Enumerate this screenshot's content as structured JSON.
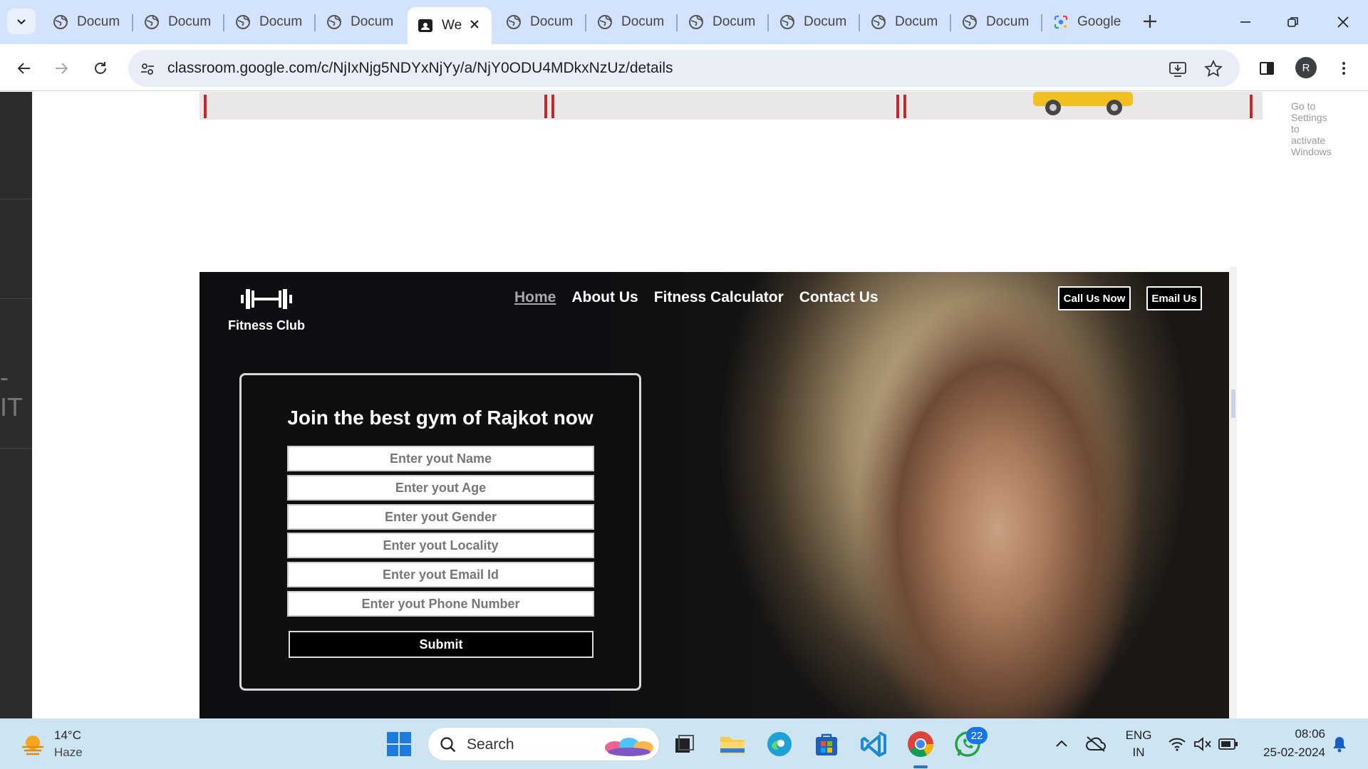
{
  "browser": {
    "tabs": [
      {
        "title": "Docum",
        "active": false
      },
      {
        "title": "Docum",
        "active": false
      },
      {
        "title": "Docum",
        "active": false
      },
      {
        "title": "Docum",
        "active": false
      },
      {
        "title": "We",
        "active": true
      },
      {
        "title": "Docum",
        "active": false
      },
      {
        "title": "Docum",
        "active": false
      },
      {
        "title": "Docum",
        "active": false
      },
      {
        "title": "Docum",
        "active": false
      },
      {
        "title": "Docum",
        "active": false
      },
      {
        "title": "Docum",
        "active": false
      },
      {
        "title": "Google",
        "active": false
      }
    ],
    "url": "classroom.google.com/c/NjIxNjg5NDYxNjYy/a/NjY0ODU4MDkxNzUz/details",
    "profile_initial": "R"
  },
  "page": {
    "left_fragment": "- IT",
    "watermark": "Go to Settings to activate Windows",
    "site": {
      "logo_text": "Fitness Club",
      "nav": [
        "Home",
        "About Us",
        "Fitness Calculator",
        "Contact Us"
      ],
      "call_button": "Call Us Now",
      "email_button": "Email Us",
      "form": {
        "title": "Join the best gym of Rajkot now",
        "fields": [
          "Enter yout Name",
          "Enter yout Age",
          "Enter yout Gender",
          "Enter yout Locality",
          "Enter yout Email Id",
          "Enter yout Phone Number"
        ],
        "submit_label": "Submit"
      }
    }
  },
  "taskbar": {
    "weather_temp": "14°C",
    "weather_desc": "Haze",
    "search_label": "Search",
    "whatsapp_badge": "22",
    "lang_top": "ENG",
    "lang_bottom": "IN",
    "time": "08:06",
    "date": "25-02-2024"
  },
  "colors": {
    "tabbar": "#d3e3fd",
    "hero_bg": "#0d0f12",
    "taskbar": "#cde4f2",
    "accent": "#1a73e8"
  }
}
